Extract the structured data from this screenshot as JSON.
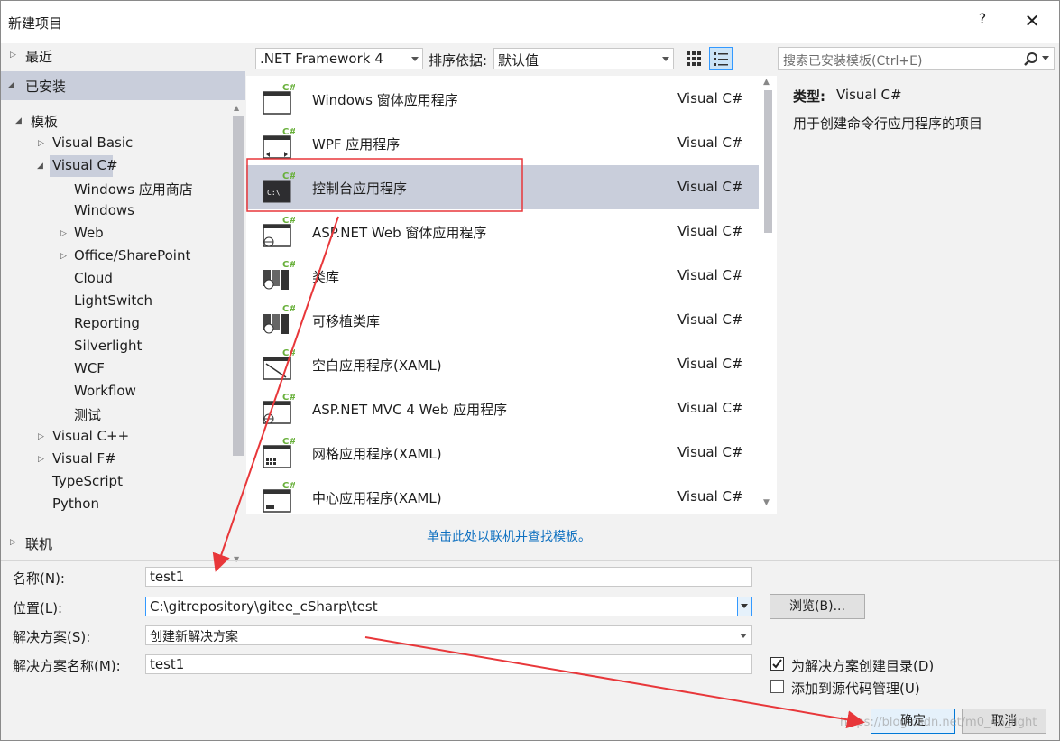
{
  "dialog": {
    "title": "新建项目",
    "help": "?",
    "close": "✕"
  },
  "tree": {
    "recent": "最近",
    "installed": "已安装",
    "templates": "模板",
    "items": [
      {
        "label": "Visual Basic"
      },
      {
        "label": "Visual C#"
      },
      {
        "label": "Windows 应用商店"
      },
      {
        "label": "Windows"
      },
      {
        "label": "Web"
      },
      {
        "label": "Office/SharePoint"
      },
      {
        "label": "Cloud"
      },
      {
        "label": "LightSwitch"
      },
      {
        "label": "Reporting"
      },
      {
        "label": "Silverlight"
      },
      {
        "label": "WCF"
      },
      {
        "label": "Workflow"
      },
      {
        "label": "测试"
      },
      {
        "label": "Visual C++"
      },
      {
        "label": "Visual F#"
      },
      {
        "label": "TypeScript"
      },
      {
        "label": "Python"
      }
    ],
    "online": "联机"
  },
  "toolbar": {
    "framework": ".NET Framework 4",
    "sort_label": "排序依据:",
    "sort_value": "默认值",
    "search_placeholder": "搜索已安装模板(Ctrl+E)"
  },
  "templates": [
    {
      "name": "Windows 窗体应用程序",
      "lang": "Visual C#"
    },
    {
      "name": "WPF 应用程序",
      "lang": "Visual C#"
    },
    {
      "name": "控制台应用程序",
      "lang": "Visual C#"
    },
    {
      "name": "ASP.NET Web 窗体应用程序",
      "lang": "Visual C#"
    },
    {
      "name": "类库",
      "lang": "Visual C#"
    },
    {
      "name": "可移植类库",
      "lang": "Visual C#"
    },
    {
      "name": "空白应用程序(XAML)",
      "lang": "Visual C#"
    },
    {
      "name": "ASP.NET MVC 4 Web 应用程序",
      "lang": "Visual C#"
    },
    {
      "name": "网格应用程序(XAML)",
      "lang": "Visual C#"
    },
    {
      "name": "中心应用程序(XAML)",
      "lang": "Visual C#"
    }
  ],
  "online_link": "单击此处以联机并查找模板。",
  "details": {
    "type_label": "类型:",
    "type_value": "Visual C#",
    "description": "用于创建命令行应用程序的项目"
  },
  "form": {
    "name_label": "名称(N):",
    "name_value": "test1",
    "location_label": "位置(L):",
    "location_value": "C:\\gitrepository\\gitee_cSharp\\test",
    "browse": "浏览(B)...",
    "solution_label": "解决方案(S):",
    "solution_value": "创建新解决方案",
    "solution_name_label": "解决方案名称(M):",
    "solution_name_value": "test1",
    "create_dir": "为解决方案创建目录(D)",
    "add_source_control": "添加到源代码管理(U)",
    "ok": "确定",
    "cancel": "取消"
  },
  "watermark": "https://blog.csdn.net/m0_46_light",
  "colors": {
    "selection": "#c9cedb",
    "link": "#0e70c0",
    "annotation": "#e8373a",
    "csharp_badge": "#68b03a"
  }
}
